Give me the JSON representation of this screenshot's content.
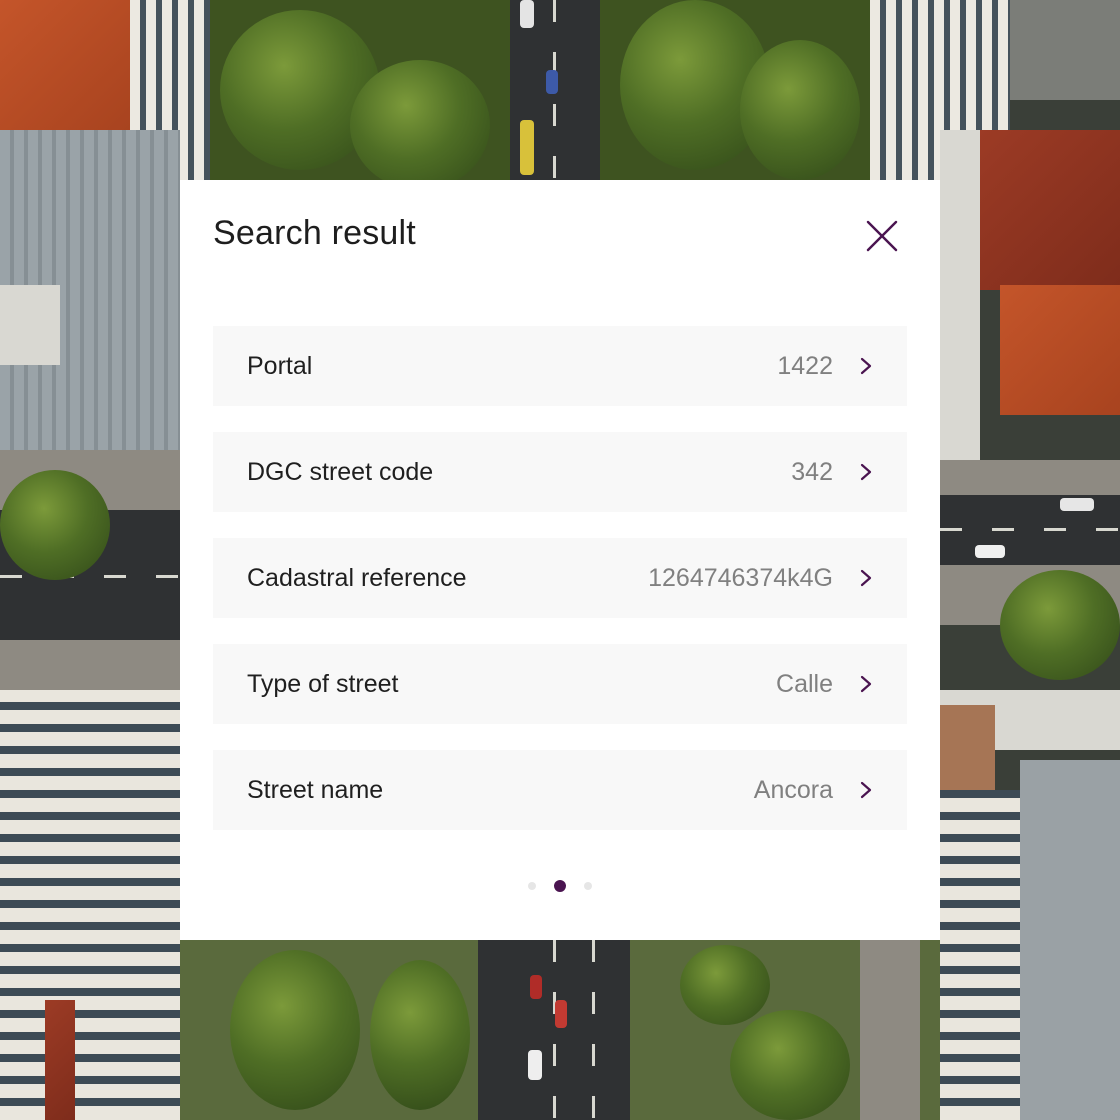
{
  "modal": {
    "title": "Search result",
    "close_icon": "close-icon",
    "rows": [
      {
        "label": "Portal",
        "value": "1422"
      },
      {
        "label": "DGC street code",
        "value": "342"
      },
      {
        "label": "Cadastral reference",
        "value": "1264746374k4G"
      },
      {
        "label": "Type of street",
        "value": "Calle"
      },
      {
        "label": "Street name",
        "value": "Ancora"
      }
    ],
    "row_icon": "chevron-right-icon",
    "pagination": {
      "pages": 3,
      "active": 2
    }
  },
  "colors": {
    "accent": "#4a1450",
    "row_background": "#f8f8f8",
    "value_text": "#808080",
    "title_text": "#1e1e1e"
  },
  "background": {
    "description_icon": "aerial-city-photo"
  }
}
